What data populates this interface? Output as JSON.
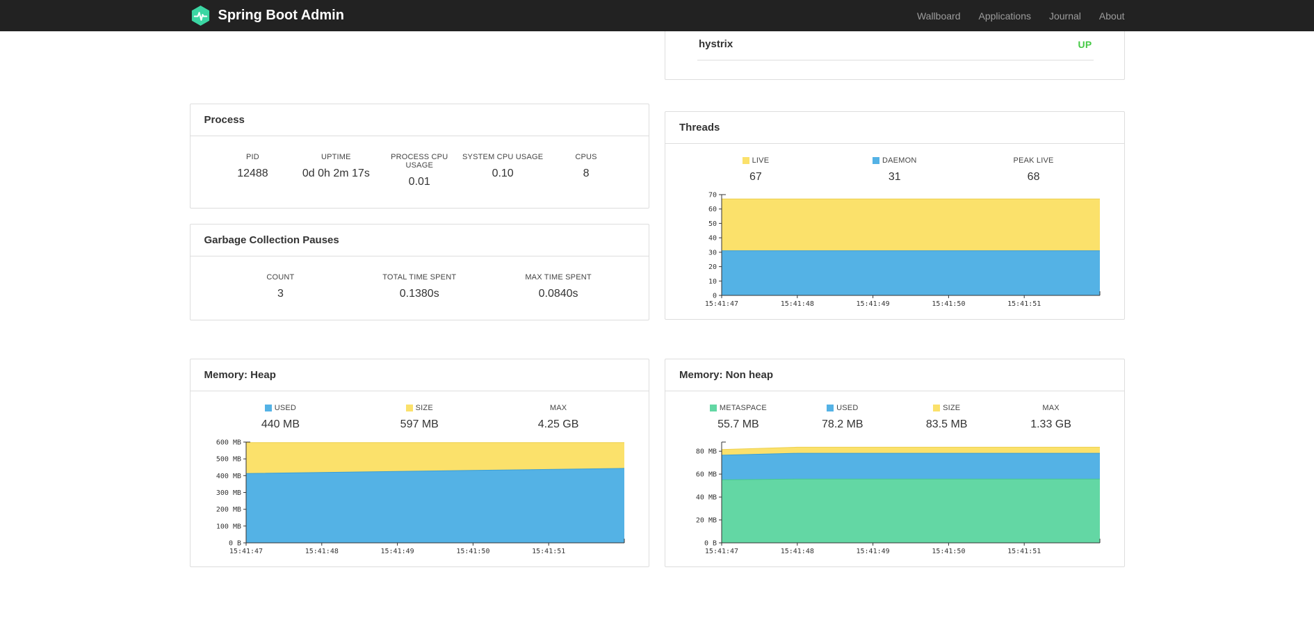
{
  "navbar": {
    "brand": "Spring Boot Admin",
    "items": [
      {
        "label": "Wallboard"
      },
      {
        "label": "Applications"
      },
      {
        "label": "Journal"
      },
      {
        "label": "About"
      }
    ]
  },
  "colors": {
    "navbar_bg": "#222222",
    "brand_logo_green": "#3bd6a3",
    "status_up": "#45c945",
    "chart_yellow": "#fbe16b",
    "chart_blue": "#54b2e5",
    "chart_green": "#63d7a4"
  },
  "applications_card": {
    "app_name": "hystrix",
    "status": "UP"
  },
  "process_card": {
    "title": "Process",
    "stats": [
      {
        "label": "PID",
        "value": "12488"
      },
      {
        "label": "UPTIME",
        "value": "0d 0h 2m 17s"
      },
      {
        "label": "PROCESS CPU USAGE",
        "value": "0.01"
      },
      {
        "label": "SYSTEM CPU USAGE",
        "value": "0.10"
      },
      {
        "label": "CPUS",
        "value": "8"
      }
    ]
  },
  "gc_card": {
    "title": "Garbage Collection Pauses",
    "stats": [
      {
        "label": "COUNT",
        "value": "3"
      },
      {
        "label": "TOTAL TIME SPENT",
        "value": "0.1380s"
      },
      {
        "label": "MAX TIME SPENT",
        "value": "0.0840s"
      }
    ]
  },
  "threads_card": {
    "title": "Threads",
    "legend": [
      {
        "label": "LIVE",
        "value": "67",
        "color": "#fbe16b"
      },
      {
        "label": "DAEMON",
        "value": "31",
        "color": "#54b2e5"
      },
      {
        "label": "PEAK LIVE",
        "value": "68",
        "color": null
      }
    ]
  },
  "heap_card": {
    "title": "Memory: Heap",
    "legend": [
      {
        "label": "USED",
        "value": "440 MB",
        "color": "#54b2e5"
      },
      {
        "label": "SIZE",
        "value": "597 MB",
        "color": "#fbe16b"
      },
      {
        "label": "MAX",
        "value": "4.25 GB",
        "color": null
      }
    ]
  },
  "nonheap_card": {
    "title": "Memory: Non heap",
    "legend": [
      {
        "label": "METASPACE",
        "value": "55.7 MB",
        "color": "#63d7a4"
      },
      {
        "label": "USED",
        "value": "78.2 MB",
        "color": "#54b2e5"
      },
      {
        "label": "SIZE",
        "value": "83.5 MB",
        "color": "#fbe16b"
      },
      {
        "label": "MAX",
        "value": "1.33 GB",
        "color": null
      }
    ]
  },
  "chart_data": [
    {
      "id": "threads-chart",
      "type": "area",
      "title": "Threads",
      "x_labels": [
        "15:41:47",
        "15:41:48",
        "15:41:49",
        "15:41:50",
        "15:41:51"
      ],
      "ylim": [
        0,
        70
      ],
      "yticks": [
        {
          "v": 0,
          "label": "0"
        },
        {
          "v": 10,
          "label": "10"
        },
        {
          "v": 20,
          "label": "20"
        },
        {
          "v": 30,
          "label": "30"
        },
        {
          "v": 40,
          "label": "40"
        },
        {
          "v": 50,
          "label": "50"
        },
        {
          "v": 60,
          "label": "60"
        },
        {
          "v": 70,
          "label": "70"
        }
      ],
      "series": [
        {
          "name": "LIVE",
          "color": "#fbe16b",
          "edge": "#edd04f",
          "values": [
            67,
            67,
            67,
            67,
            67,
            67
          ]
        },
        {
          "name": "DAEMON",
          "color": "#54b2e5",
          "edge": "#3a9ed6",
          "values": [
            31,
            31,
            31,
            31,
            31,
            31
          ]
        }
      ]
    },
    {
      "id": "heap-chart",
      "type": "area",
      "title": "Memory: Heap",
      "x_labels": [
        "15:41:47",
        "15:41:48",
        "15:41:49",
        "15:41:50",
        "15:41:51"
      ],
      "ylim": [
        0,
        600
      ],
      "yticks": [
        {
          "v": 0,
          "label": "0 B"
        },
        {
          "v": 100,
          "label": "100 MB"
        },
        {
          "v": 200,
          "label": "200 MB"
        },
        {
          "v": 300,
          "label": "300 MB"
        },
        {
          "v": 400,
          "label": "400 MB"
        },
        {
          "v": 500,
          "label": "500 MB"
        },
        {
          "v": 600,
          "label": "600 MB"
        }
      ],
      "series": [
        {
          "name": "SIZE",
          "color": "#fbe16b",
          "edge": "#edd04f",
          "values": [
            597,
            597,
            597,
            597,
            597,
            597
          ]
        },
        {
          "name": "USED",
          "color": "#54b2e5",
          "edge": "#3a9ed6",
          "values": [
            413,
            419,
            425,
            431,
            437,
            443
          ]
        }
      ]
    },
    {
      "id": "nonheap-chart",
      "type": "area",
      "title": "Memory: Non heap",
      "x_labels": [
        "15:41:47",
        "15:41:48",
        "15:41:49",
        "15:41:50",
        "15:41:51"
      ],
      "ylim": [
        0,
        88
      ],
      "yticks": [
        {
          "v": 0,
          "label": "0 B"
        },
        {
          "v": 20,
          "label": "20 MB"
        },
        {
          "v": 40,
          "label": "40 MB"
        },
        {
          "v": 60,
          "label": "60 MB"
        },
        {
          "v": 80,
          "label": "80 MB"
        }
      ],
      "series": [
        {
          "name": "SIZE",
          "color": "#fbe16b",
          "edge": "#edd04f",
          "values": [
            81.5,
            83.5,
            83.5,
            83.5,
            83.5,
            83.5
          ]
        },
        {
          "name": "USED",
          "color": "#54b2e5",
          "edge": "#3a9ed6",
          "values": [
            76.5,
            78.2,
            78.2,
            78.2,
            78.2,
            78.2
          ]
        },
        {
          "name": "METASPACE",
          "color": "#63d7a4",
          "edge": "#47c790",
          "values": [
            55.0,
            55.7,
            55.7,
            55.7,
            55.7,
            55.7
          ]
        }
      ]
    }
  ]
}
